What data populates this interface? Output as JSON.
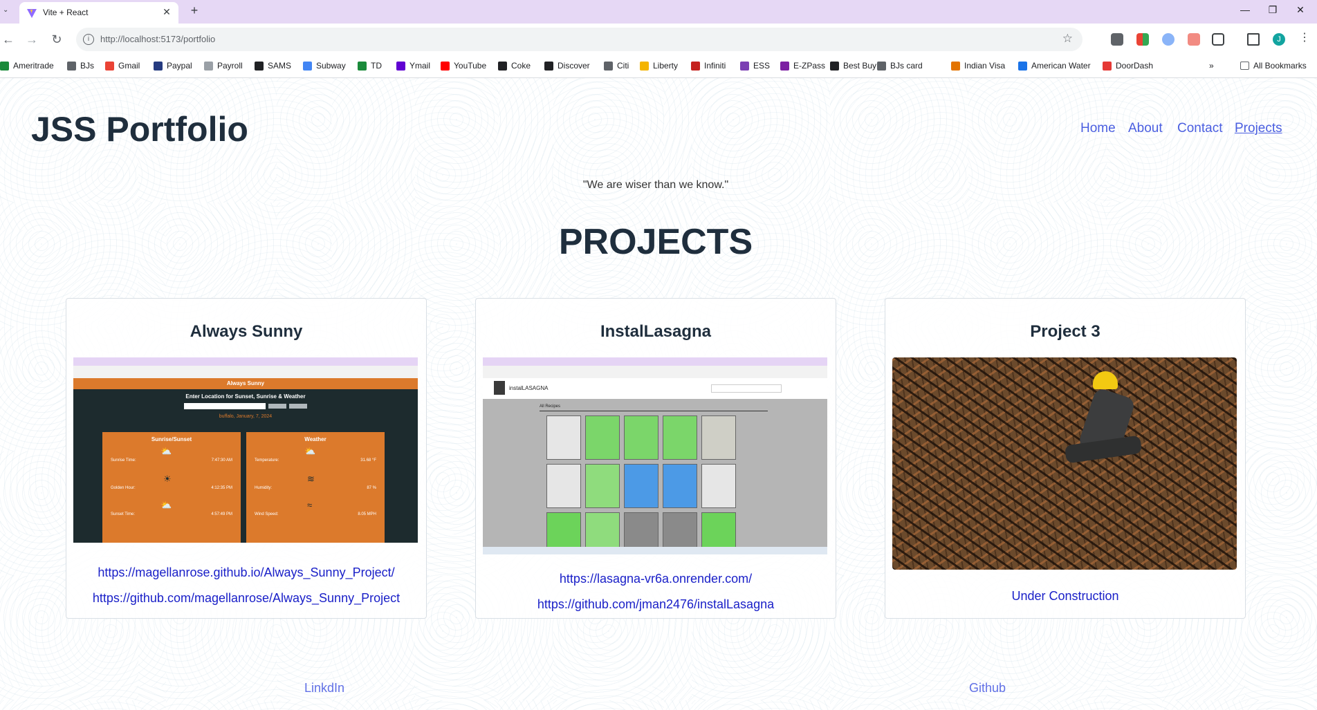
{
  "browser": {
    "tab_title": "Vite + React",
    "url": "http://localhost:5173/portfolio",
    "bookmarks": [
      "Ameritrade",
      "BJs",
      "Gmail",
      "Paypal",
      "Payroll",
      "SAMS",
      "Subway",
      "TD",
      "Ymail",
      "YouTube",
      "Coke",
      "Discover",
      "Citi",
      "Liberty",
      "Infiniti",
      "ESS",
      "E-ZPass",
      "Best Buy",
      "BJs card",
      "Indian Visa",
      "American Water",
      "DoorDash"
    ],
    "all_bookmarks": "All Bookmarks",
    "avatar_letter": "J",
    "more_chevron": "»"
  },
  "header": {
    "brand": "JSS Portfolio",
    "nav": [
      "Home",
      "About",
      "Contact",
      "Projects"
    ],
    "active_nav": "Projects"
  },
  "quote": "\"We are wiser than we know.\"",
  "page_title": "PROJECTS",
  "projects": [
    {
      "title": "Always Sunny",
      "links": [
        "https://magellanrose.github.io/Always_Sunny_Project/",
        "https://github.com/magellanrose/Always_Sunny_Project"
      ],
      "preview": {
        "app_title": "Always Sunny",
        "prompt": "Enter Location for Sunset, Sunrise & Weather",
        "location": "buffalo, January, 7, 2024",
        "left_panel": {
          "title": "Sunrise/Sunset",
          "rows": [
            [
              "Sunrise Time:",
              "7:47:30 AM"
            ],
            [
              "Golden Hour:",
              "4:12:35 PM"
            ],
            [
              "Sunset Time:",
              "4:57:49 PM"
            ]
          ]
        },
        "right_panel": {
          "title": "Weather",
          "rows": [
            [
              "Temperature:",
              "31.68 °F"
            ],
            [
              "Humidity:",
              "87 %"
            ],
            [
              "Wind Speed:",
              "8.05 MPH"
            ]
          ]
        }
      }
    },
    {
      "title": "InstalLasagna",
      "links": [
        "https://lasagna-vr6a.onrender.com/",
        "https://github.com/jman2476/instalLasagna"
      ],
      "preview": {
        "app_title": "instalLASAGNA",
        "section": "All Recipes"
      }
    },
    {
      "title": "Project 3",
      "links": [
        "Under Construction"
      ]
    }
  ],
  "footer": {
    "left": "LinkdIn",
    "right": "Github"
  },
  "colors": {
    "brand": "#1f2e3d",
    "nav": "#4a5ee0",
    "link": "#1a20c8",
    "footer_link": "#6170e6",
    "sunny_orange": "#dc7a2c",
    "sunny_dark": "#1d2b2e"
  }
}
